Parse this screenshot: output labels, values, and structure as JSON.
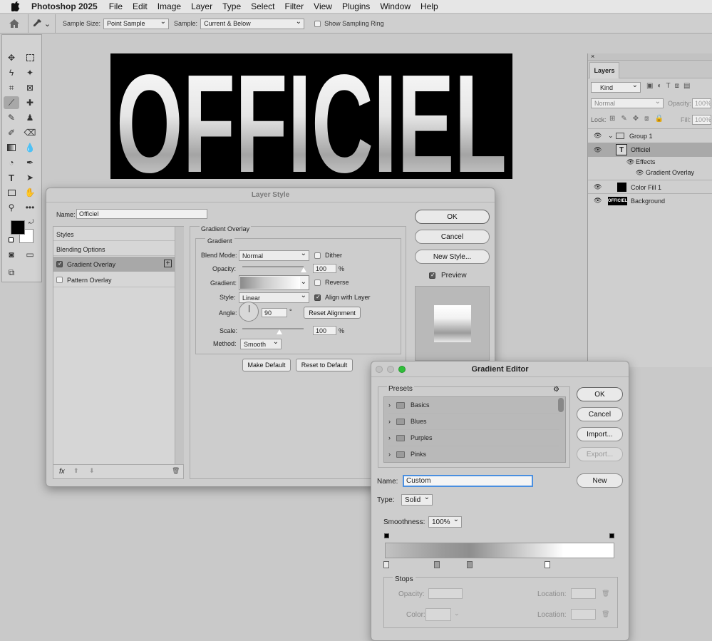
{
  "menubar": {
    "app": "Photoshop 2025",
    "items": [
      "File",
      "Edit",
      "Image",
      "Layer",
      "Type",
      "Select",
      "Filter",
      "View",
      "Plugins",
      "Window",
      "Help"
    ]
  },
  "options": {
    "sample_size_label": "Sample Size:",
    "sample_size_value": "Point Sample",
    "sample_label": "Sample:",
    "sample_value": "Current & Below",
    "show_ring_label": "Show Sampling Ring"
  },
  "canvas": {
    "text": "OFFICIEL"
  },
  "layers_panel": {
    "tab": "Layers",
    "kind": "Kind",
    "blend": "Normal",
    "opacity_label": "Opacity:",
    "opacity_value": "100%",
    "lock_label": "Lock:",
    "fill_label": "Fill:",
    "fill_value": "100%",
    "layers": [
      {
        "name": "Group 1"
      },
      {
        "name": "Officiel"
      },
      {
        "name": "Effects"
      },
      {
        "name": "Gradient Overlay"
      },
      {
        "name": "Color Fill 1"
      },
      {
        "name": "Background",
        "thumb_text": "OFFICIEL"
      }
    ]
  },
  "layer_style": {
    "title": "Layer Style",
    "name_label": "Name:",
    "name_value": "Officiel",
    "left_items": [
      "Styles",
      "Blending Options",
      "Gradient Overlay",
      "Pattern Overlay"
    ],
    "section_title": "Gradient Overlay",
    "group_title": "Gradient",
    "blend_mode_label": "Blend Mode:",
    "blend_mode_value": "Normal",
    "dither_label": "Dither",
    "opacity_label": "Opacity:",
    "opacity_value": "100",
    "opacity_unit": "%",
    "opacity_fraction": 1.0,
    "gradient_label": "Gradient:",
    "reverse_label": "Reverse",
    "style_label": "Style:",
    "style_value": "Linear",
    "align_label": "Align with Layer",
    "angle_label": "Angle:",
    "angle_value": "90",
    "angle_unit": "°",
    "reset_alignment": "Reset Alignment",
    "scale_label": "Scale:",
    "scale_value": "100",
    "scale_unit": "%",
    "scale_fraction": 0.6,
    "method_label": "Method:",
    "method_value": "Smooth",
    "make_default": "Make Default",
    "reset_default": "Reset to Default",
    "ok": "OK",
    "cancel": "Cancel",
    "new_style": "New Style...",
    "preview_label": "Preview",
    "fx_label": "fx"
  },
  "gradient_editor": {
    "title": "Gradient Editor",
    "presets_label": "Presets",
    "presets": [
      "Basics",
      "Blues",
      "Purples",
      "Pinks"
    ],
    "ok": "OK",
    "cancel": "Cancel",
    "import": "Import...",
    "export": "Export...",
    "name_label": "Name:",
    "name_value": "Custom",
    "new": "New",
    "type_label": "Type:",
    "type_value": "Solid",
    "smoothness_label": "Smoothness:",
    "smoothness_value": "100%",
    "stops_label": "Stops",
    "opacity_label": "Opacity:",
    "color_label": "Color:",
    "location_label": "Location:",
    "location_label2": "Location:",
    "colors": {
      "gradient_dark": "#8a8a8a",
      "gradient_light": "#ffffff"
    }
  }
}
